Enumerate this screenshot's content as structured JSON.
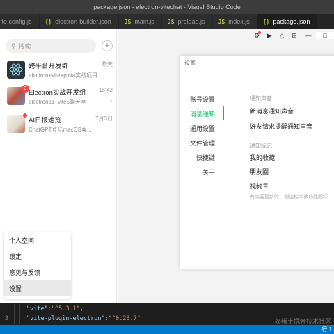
{
  "window": {
    "title": "package.json - electron-vitechat - Visual Studio Code"
  },
  "editor_tabs": [
    {
      "icon": "curly-braces-icon",
      "label": "vite.config.js",
      "active": false
    },
    {
      "icon": "curly-braces-icon",
      "label": "electron-builder.json",
      "active": false
    },
    {
      "icon": "js-file-icon",
      "label": "main.js",
      "active": false
    },
    {
      "icon": "js-file-icon",
      "label": "preload.js",
      "active": false
    },
    {
      "icon": "js-file-icon",
      "label": "index.js",
      "active": false
    },
    {
      "icon": "curly-braces-icon",
      "label": "package.json",
      "active": true
    }
  ],
  "chat_list": {
    "search_placeholder": "搜索",
    "add_label": "+",
    "items": [
      {
        "name": "跨平台开发群",
        "preview": "electron+vite+pinia实战项目...",
        "time": "昨天",
        "badge": "",
        "avatar": "electron-logo"
      },
      {
        "name": "Electron实战开发组",
        "preview": "electron31+vite5聊天室",
        "time": "18:42",
        "badge": "3",
        "avatar": "group-photo"
      },
      {
        "name": "AI日报速览",
        "preview": "ChatGPT登陆macOS桌...",
        "time": "7月3日",
        "badge": "dot",
        "avatar": "ai-news"
      }
    ]
  },
  "popup_menu": {
    "items": [
      "个人空间",
      "锁定",
      "意见与反馈",
      "设置"
    ],
    "selected": "设置"
  },
  "top_icons": [
    "settings-gear-icon",
    "play-circle-icon",
    "shirt-icon",
    "grid-icon",
    "minimize-icon",
    "maximize-icon"
  ],
  "settings": {
    "title": "设置",
    "nav": [
      "账号设置",
      "消息通知",
      "通用设置",
      "文件管理",
      "快捷键",
      "关于"
    ],
    "active_nav": "消息通知",
    "section1_header": "通知声音",
    "option1": "新消息通知声音",
    "option2": "好友请求提醒通知声音",
    "section2_header": "通知标记",
    "option3": "我的收藏",
    "option4": "朋友圈",
    "option5": "视频号",
    "hint": "有内容更新时，侧边栏中该功能图标"
  },
  "code": {
    "lines": [
      {
        "num": "",
        "key": "\"vite\"",
        "sep": ": ",
        "value": "\"^5.3.1\"",
        "tail": ","
      },
      {
        "num": "3",
        "key": "\"vite-plugin-electron\"",
        "sep": ": ",
        "value": "\"^0.28.7\"",
        "tail": ""
      }
    ],
    "watermark": "@稀土掘金技术社区"
  },
  "statusbar": {
    "position": "行 1"
  },
  "colors": {
    "accent_green": "#07c160",
    "badge_red": "#f04848",
    "vscode_blue": "#007acc"
  }
}
